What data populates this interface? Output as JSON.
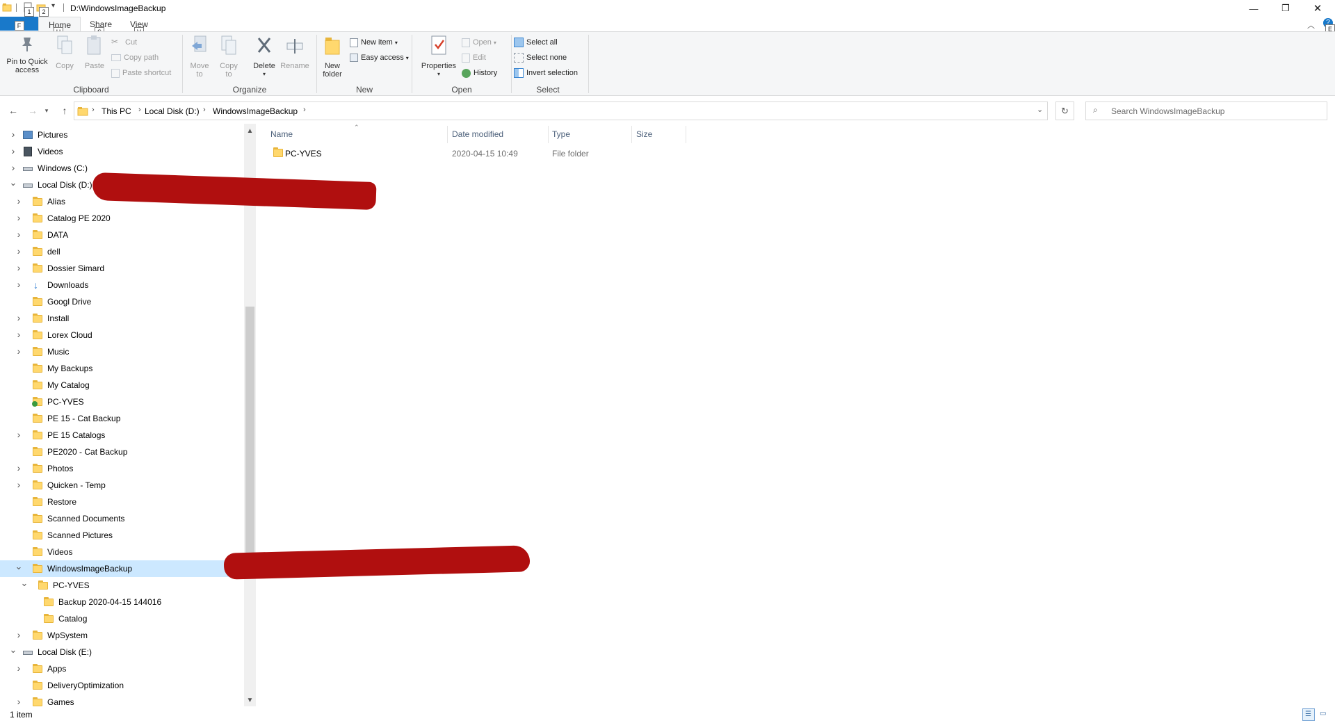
{
  "window": {
    "title": "D:\\WindowsImageBackup",
    "keytips_qat": [
      "1",
      "2"
    ],
    "minimize_icon": "minimize-icon",
    "maximize_icon": "restore-icon",
    "close_icon": "close-icon"
  },
  "tabs": {
    "file": "F",
    "home": "Home",
    "share": "Share",
    "view": "View",
    "home_keytip": "H",
    "share_keytip": "S",
    "view_keytip": "V",
    "help_keytip": "E"
  },
  "ribbon": {
    "clipboard": {
      "group": "Clipboard",
      "pin": "Pin to Quick\naccess",
      "copy": "Copy",
      "paste": "Paste",
      "cut": "Cut",
      "copy_path": "Copy path",
      "paste_shortcut": "Paste shortcut"
    },
    "organize": {
      "group": "Organize",
      "move_to": "Move\nto",
      "copy_to": "Copy\nto",
      "delete": "Delete",
      "rename": "Rename"
    },
    "new": {
      "group": "New",
      "new_folder": "New\nfolder",
      "new_item": "New item",
      "easy_access": "Easy access"
    },
    "open": {
      "group": "Open",
      "properties": "Properties",
      "open": "Open",
      "edit": "Edit",
      "history": "History"
    },
    "select": {
      "group": "Select",
      "select_all": "Select all",
      "select_none": "Select none",
      "invert": "Invert selection"
    }
  },
  "address": {
    "crumbs": [
      "This PC",
      "Local Disk (D:)",
      "WindowsImageBackup"
    ],
    "search_placeholder": "Search WindowsImageBackup"
  },
  "tree": [
    {
      "label": "Pictures",
      "level": 0,
      "expand": "collapsed",
      "icon": "pictures-icon"
    },
    {
      "label": "Videos",
      "level": 0,
      "expand": "collapsed",
      "icon": "videos-icon"
    },
    {
      "label": "Windows (C:)",
      "level": 0,
      "expand": "collapsed",
      "icon": "drive-icon"
    },
    {
      "label": "Local Disk (D:)",
      "level": 0,
      "expand": "expanded",
      "icon": "drive-icon"
    },
    {
      "label": "Alias",
      "level": 1,
      "expand": "collapsed",
      "icon": "folder-icon"
    },
    {
      "label": "Catalog PE 2020",
      "level": 1,
      "expand": "collapsed",
      "icon": "folder-icon"
    },
    {
      "label": "DATA",
      "level": 1,
      "expand": "collapsed",
      "icon": "folder-icon"
    },
    {
      "label": "dell",
      "level": 1,
      "expand": "collapsed",
      "icon": "folder-icon"
    },
    {
      "label": "Dossier Simard",
      "level": 1,
      "expand": "collapsed",
      "icon": "folder-icon"
    },
    {
      "label": "Downloads",
      "level": 1,
      "expand": "collapsed",
      "icon": "downloads-icon"
    },
    {
      "label": "Googl Drive",
      "level": 1,
      "expand": "none",
      "icon": "folder-icon"
    },
    {
      "label": "Install",
      "level": 1,
      "expand": "collapsed",
      "icon": "folder-icon"
    },
    {
      "label": "Lorex Cloud",
      "level": 1,
      "expand": "collapsed",
      "icon": "folder-icon"
    },
    {
      "label": "Music",
      "level": 1,
      "expand": "collapsed",
      "icon": "folder-icon"
    },
    {
      "label": "My Backups",
      "level": 1,
      "expand": "none",
      "icon": "folder-icon"
    },
    {
      "label": "My Catalog",
      "level": 1,
      "expand": "none",
      "icon": "folder-icon"
    },
    {
      "label": "PC-YVES",
      "level": 1,
      "expand": "none",
      "icon": "sync-folder-icon"
    },
    {
      "label": "PE 15 - Cat Backup",
      "level": 1,
      "expand": "none",
      "icon": "folder-icon"
    },
    {
      "label": "PE 15 Catalogs",
      "level": 1,
      "expand": "collapsed",
      "icon": "folder-icon"
    },
    {
      "label": "PE2020 - Cat Backup",
      "level": 1,
      "expand": "none",
      "icon": "folder-icon"
    },
    {
      "label": "Photos",
      "level": 1,
      "expand": "collapsed",
      "icon": "folder-icon"
    },
    {
      "label": "Quicken - Temp",
      "level": 1,
      "expand": "collapsed",
      "icon": "folder-icon"
    },
    {
      "label": "Restore",
      "level": 1,
      "expand": "none",
      "icon": "folder-icon"
    },
    {
      "label": "Scanned Documents",
      "level": 1,
      "expand": "none",
      "icon": "folder-icon"
    },
    {
      "label": "Scanned Pictures",
      "level": 1,
      "expand": "none",
      "icon": "folder-icon"
    },
    {
      "label": "Videos",
      "level": 1,
      "expand": "none",
      "icon": "folder-icon"
    },
    {
      "label": "WindowsImageBackup",
      "level": 1,
      "expand": "expanded",
      "icon": "folder-icon",
      "selected": true
    },
    {
      "label": "PC-YVES",
      "level": 2,
      "expand": "expanded",
      "icon": "folder-icon"
    },
    {
      "label": "Backup 2020-04-15 144016",
      "level": 3,
      "expand": "none",
      "icon": "folder-icon"
    },
    {
      "label": "Catalog",
      "level": 3,
      "expand": "none",
      "icon": "folder-icon"
    },
    {
      "label": "WpSystem",
      "level": 1,
      "expand": "collapsed",
      "icon": "folder-icon"
    },
    {
      "label": "Local Disk (E:)",
      "level": 0,
      "expand": "expanded",
      "icon": "drive-icon"
    },
    {
      "label": "Apps",
      "level": 1,
      "expand": "collapsed",
      "icon": "folder-icon"
    },
    {
      "label": "DeliveryOptimization",
      "level": 1,
      "expand": "none",
      "icon": "folder-icon"
    },
    {
      "label": "Games",
      "level": 1,
      "expand": "collapsed",
      "icon": "folder-icon"
    }
  ],
  "columns": {
    "name": "Name",
    "date": "Date modified",
    "type": "Type",
    "size": "Size"
  },
  "files": [
    {
      "name": "PC-YVES",
      "date": "2020-04-15 10:49",
      "type": "File folder",
      "size": ""
    }
  ],
  "status": {
    "items": "1 item"
  },
  "colors": {
    "accent": "#1979ca",
    "selection": "#cce8ff",
    "redaction": "#b00f0f"
  }
}
